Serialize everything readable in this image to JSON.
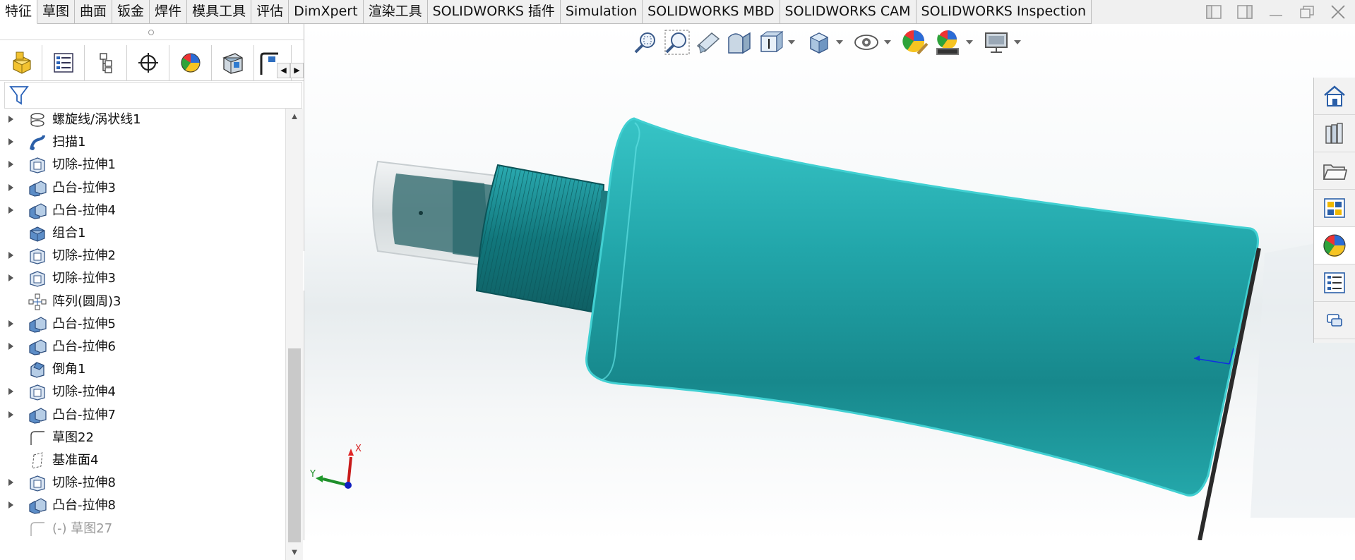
{
  "ribbon_tabs": [
    {
      "label": "特征",
      "active": true
    },
    {
      "label": "草图"
    },
    {
      "label": "曲面"
    },
    {
      "label": "钣金"
    },
    {
      "label": "焊件"
    },
    {
      "label": "模具工具"
    },
    {
      "label": "评估"
    },
    {
      "label": "DimXpert"
    },
    {
      "label": "渲染工具"
    },
    {
      "label": "SOLIDWORKS 插件"
    },
    {
      "label": "Simulation"
    },
    {
      "label": "SOLIDWORKS MBD"
    },
    {
      "label": "SOLIDWORKS CAM"
    },
    {
      "label": "SOLIDWORKS Inspection"
    }
  ],
  "window_controls": [
    "tile-left-icon",
    "tile-right-icon",
    "minimize-icon",
    "restore-icon",
    "close-icon"
  ],
  "manager_tabs": [
    "featuremanager-icon",
    "propertymanager-icon",
    "configurationmanager-icon",
    "dimxpert-icon",
    "display-manager-icon",
    "cam-manager-icon",
    "extra-tab-icon"
  ],
  "feature_tree": [
    {
      "label": "螺旋线/涡状线1",
      "icon": "helix-icon",
      "expandable": true
    },
    {
      "label": "扫描1",
      "icon": "sweep-icon",
      "expandable": true
    },
    {
      "label": "切除-拉伸1",
      "icon": "cut-extrude-icon",
      "expandable": true
    },
    {
      "label": "凸台-拉伸3",
      "icon": "boss-extrude-icon",
      "expandable": true
    },
    {
      "label": "凸台-拉伸4",
      "icon": "boss-extrude-icon",
      "expandable": true
    },
    {
      "label": "组合1",
      "icon": "combine-icon",
      "expandable": false
    },
    {
      "label": "切除-拉伸2",
      "icon": "cut-extrude-icon",
      "expandable": true
    },
    {
      "label": "切除-拉伸3",
      "icon": "cut-extrude-icon",
      "expandable": true
    },
    {
      "label": "阵列(圆周)3",
      "icon": "circular-pattern-icon",
      "expandable": false
    },
    {
      "label": "凸台-拉伸5",
      "icon": "boss-extrude-icon",
      "expandable": true
    },
    {
      "label": "凸台-拉伸6",
      "icon": "boss-extrude-icon",
      "expandable": true
    },
    {
      "label": "倒角1",
      "icon": "chamfer-icon",
      "expandable": false
    },
    {
      "label": "切除-拉伸4",
      "icon": "cut-extrude-icon",
      "expandable": true
    },
    {
      "label": "凸台-拉伸7",
      "icon": "boss-extrude-icon",
      "expandable": true
    },
    {
      "label": "草图22",
      "icon": "sketch-icon",
      "expandable": false
    },
    {
      "label": "基准面4",
      "icon": "plane-icon",
      "expandable": false
    },
    {
      "label": "切除-拉伸8",
      "icon": "cut-extrude-icon",
      "expandable": true
    },
    {
      "label": "凸台-拉伸8",
      "icon": "boss-extrude-icon",
      "expandable": true
    },
    {
      "label": "(-) 草图27",
      "icon": "sketch-icon",
      "expandable": false,
      "suppressed": true
    }
  ],
  "headsup_toolbar": [
    "zoom-to-fit-icon",
    "zoom-to-area-icon",
    "previous-view-icon",
    "section-view-icon",
    "view-orientation-icon",
    "display-style-icon",
    "hide-show-items-icon",
    "edit-appearance-icon",
    "apply-scene-icon",
    "view-settings-icon"
  ],
  "task_pane": [
    "solidworks-resources-icon",
    "design-library-icon",
    "file-explorer-icon",
    "view-palette-icon",
    "appearances-scenes-icon",
    "custom-properties-icon",
    "forum-icon"
  ],
  "triad": {
    "x_label": "X",
    "y_label": "Y"
  },
  "colors": {
    "model": "#1f9da3",
    "accent_x": "#d62020",
    "accent_y": "#1f8f2a",
    "accent_z": "#1020c0"
  }
}
